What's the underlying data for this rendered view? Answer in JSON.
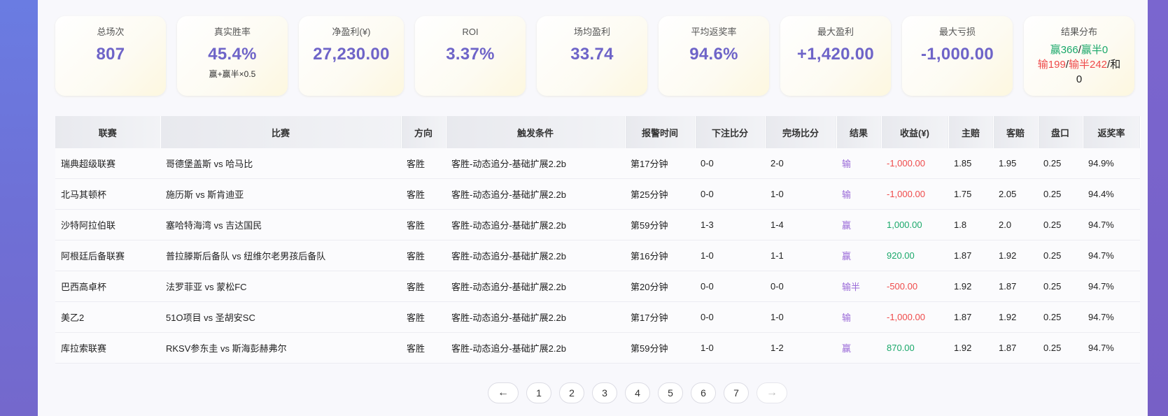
{
  "stats": [
    {
      "label": "总场次",
      "value": "807"
    },
    {
      "label": "真实胜率",
      "value": "45.4%",
      "sub": "赢+赢半×0.5"
    },
    {
      "label": "净盈利(¥)",
      "value": "27,230.00"
    },
    {
      "label": "ROI",
      "value": "3.37%"
    },
    {
      "label": "场均盈利",
      "value": "33.74"
    },
    {
      "label": "平均返奖率",
      "value": "94.6%"
    },
    {
      "label": "最大盈利",
      "value": "+1,420.00"
    },
    {
      "label": "最大亏损",
      "value": "-1,000.00"
    }
  ],
  "distribution": {
    "label": "结果分布",
    "win": "赢366",
    "sep1": "/",
    "win_half": "赢半0",
    "loss": "输199",
    "sep2": "/",
    "loss_half": "输半242",
    "sep3": "/和",
    "draw": "0"
  },
  "table": {
    "headers": [
      "联赛",
      "比赛",
      "方向",
      "触发条件",
      "报警时间",
      "下注比分",
      "完场比分",
      "结果",
      "收益(¥)",
      "主赔",
      "客赔",
      "盘口",
      "返奖率"
    ],
    "rows": [
      {
        "league": "瑞典超级联赛",
        "match": "哥德堡盖斯 vs 哈马比",
        "dir": "客胜",
        "cond": "客胜-动态追分-基础扩展2.2b",
        "time": "第17分钟",
        "bet": "0-0",
        "final": "2-0",
        "result": "输",
        "profit": "-1,000.00",
        "home": "1.85",
        "away": "1.95",
        "line": "0.25",
        "ret": "94.9%"
      },
      {
        "league": "北马其顿杯",
        "match": "施历斯 vs 斯肯迪亚",
        "dir": "客胜",
        "cond": "客胜-动态追分-基础扩展2.2b",
        "time": "第25分钟",
        "bet": "0-0",
        "final": "1-0",
        "result": "输",
        "profit": "-1,000.00",
        "home": "1.75",
        "away": "2.05",
        "line": "0.25",
        "ret": "94.4%"
      },
      {
        "league": "沙特阿拉伯联",
        "match": "塞哈特海湾 vs 吉达国民",
        "dir": "客胜",
        "cond": "客胜-动态追分-基础扩展2.2b",
        "time": "第59分钟",
        "bet": "1-3",
        "final": "1-4",
        "result": "赢",
        "profit": "1,000.00",
        "home": "1.8",
        "away": "2.0",
        "line": "0.25",
        "ret": "94.7%"
      },
      {
        "league": "阿根廷后备联赛",
        "match": "普拉滕斯后备队 vs 纽维尔老男孩后备队",
        "dir": "客胜",
        "cond": "客胜-动态追分-基础扩展2.2b",
        "time": "第16分钟",
        "bet": "1-0",
        "final": "1-1",
        "result": "赢",
        "profit": "920.00",
        "home": "1.87",
        "away": "1.92",
        "line": "0.25",
        "ret": "94.7%"
      },
      {
        "league": "巴西高卓杯",
        "match": "法罗菲亚 vs 蒙松FC",
        "dir": "客胜",
        "cond": "客胜-动态追分-基础扩展2.2b",
        "time": "第20分钟",
        "bet": "0-0",
        "final": "0-0",
        "result": "输半",
        "profit": "-500.00",
        "home": "1.92",
        "away": "1.87",
        "line": "0.25",
        "ret": "94.7%"
      },
      {
        "league": "美乙2",
        "match": "51O项目 vs 圣胡安SC",
        "dir": "客胜",
        "cond": "客胜-动态追分-基础扩展2.2b",
        "time": "第17分钟",
        "bet": "0-0",
        "final": "1-0",
        "result": "输",
        "profit": "-1,000.00",
        "home": "1.87",
        "away": "1.92",
        "line": "0.25",
        "ret": "94.7%"
      },
      {
        "league": "库拉索联赛",
        "match": "RKSV参东圭 vs 斯海彭赫弗尔",
        "dir": "客胜",
        "cond": "客胜-动态追分-基础扩展2.2b",
        "time": "第59分钟",
        "bet": "1-0",
        "final": "1-2",
        "result": "赢",
        "profit": "870.00",
        "home": "1.92",
        "away": "1.87",
        "line": "0.25",
        "ret": "94.7%"
      }
    ]
  },
  "pagination": {
    "prev": "←",
    "pages": [
      "1",
      "2",
      "3",
      "4",
      "5",
      "6",
      "7"
    ],
    "next": "→"
  }
}
